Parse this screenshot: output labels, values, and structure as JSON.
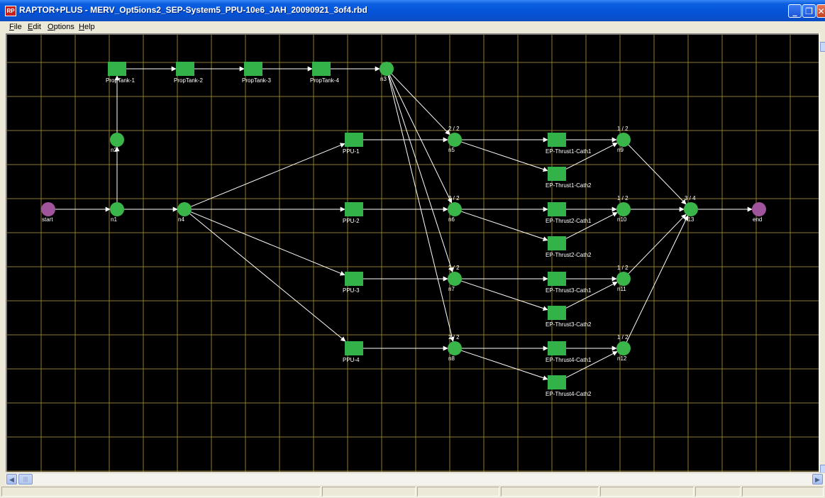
{
  "window": {
    "title": "RAPTOR+PLUS - MERV_Opt5ions2_SEP-System5_PPU-10e6_JAH_20090921_3of4.rbd"
  },
  "menu": [
    {
      "label": "File"
    },
    {
      "label": "Edit"
    },
    {
      "label": "Options"
    },
    {
      "label": "Help"
    }
  ],
  "colors": {
    "block": "#33b24a",
    "node": "#3ab54a",
    "terminal": "#a0549b",
    "grid": "#8f7a2e",
    "canvas": "#000000",
    "label": "#ffffff"
  },
  "diagram": {
    "terminals": [
      {
        "id": "start",
        "label": "start"
      },
      {
        "id": "end",
        "label": "end"
      }
    ],
    "nodes": [
      {
        "id": "n1",
        "label": "n1",
        "vote": ""
      },
      {
        "id": "n2",
        "label": "n2",
        "vote": ""
      },
      {
        "id": "n3",
        "label": "n3",
        "vote": ""
      },
      {
        "id": "n4",
        "label": "n4",
        "vote": ""
      },
      {
        "id": "n5",
        "label": "n5",
        "vote": "2 / 2"
      },
      {
        "id": "n6",
        "label": "n6",
        "vote": "2 / 2"
      },
      {
        "id": "n7",
        "label": "n7",
        "vote": "2 / 2"
      },
      {
        "id": "n8",
        "label": "n8",
        "vote": "2 / 2"
      },
      {
        "id": "n9",
        "label": "n9",
        "vote": "1 / 2"
      },
      {
        "id": "n10",
        "label": "n10",
        "vote": "1 / 2"
      },
      {
        "id": "n11",
        "label": "n11",
        "vote": "1 / 2"
      },
      {
        "id": "n12",
        "label": "n12",
        "vote": "1 / 2"
      },
      {
        "id": "n13",
        "label": "n13",
        "vote": "3 / 4"
      }
    ],
    "blocks": [
      {
        "id": "pt1",
        "label": "PropTank-1"
      },
      {
        "id": "pt2",
        "label": "PropTank-2"
      },
      {
        "id": "pt3",
        "label": "PropTank-3"
      },
      {
        "id": "pt4",
        "label": "PropTank-4"
      },
      {
        "id": "ppu1",
        "label": "PPU-1"
      },
      {
        "id": "ppu2",
        "label": "PPU-2"
      },
      {
        "id": "ppu3",
        "label": "PPU-3"
      },
      {
        "id": "ppu4",
        "label": "PPU-4"
      },
      {
        "id": "t1c1",
        "label": "EP-Thrust1-Cath1"
      },
      {
        "id": "t1c2",
        "label": "EP-Thrust1-Cath2"
      },
      {
        "id": "t2c1",
        "label": "EP-Thrust2-Cath1"
      },
      {
        "id": "t2c2",
        "label": "EP-Thrust2-Cath2"
      },
      {
        "id": "t3c1",
        "label": "EP-Thrust3-Cath1"
      },
      {
        "id": "t3c2",
        "label": "EP-Thrust3-Cath2"
      },
      {
        "id": "t4c1",
        "label": "EP-Thrust4-Cath1"
      },
      {
        "id": "t4c2",
        "label": "EP-Thrust4-Cath2"
      }
    ],
    "links": [
      [
        "start",
        "n1"
      ],
      [
        "n1",
        "n2"
      ],
      [
        "n1",
        "n4"
      ],
      [
        "n2",
        "pt1"
      ],
      [
        "pt1",
        "pt2"
      ],
      [
        "pt2",
        "pt3"
      ],
      [
        "pt3",
        "pt4"
      ],
      [
        "pt4",
        "n3"
      ],
      [
        "n4",
        "ppu1"
      ],
      [
        "n4",
        "ppu2"
      ],
      [
        "n4",
        "ppu3"
      ],
      [
        "n4",
        "ppu4"
      ],
      [
        "n3",
        "n5"
      ],
      [
        "n3",
        "n6"
      ],
      [
        "n3",
        "n7"
      ],
      [
        "n3",
        "n8"
      ],
      [
        "ppu1",
        "n5"
      ],
      [
        "ppu2",
        "n6"
      ],
      [
        "ppu3",
        "n7"
      ],
      [
        "ppu4",
        "n8"
      ],
      [
        "n5",
        "t1c1"
      ],
      [
        "n5",
        "t1c2"
      ],
      [
        "n6",
        "t2c1"
      ],
      [
        "n6",
        "t2c2"
      ],
      [
        "n7",
        "t3c1"
      ],
      [
        "n7",
        "t3c2"
      ],
      [
        "n8",
        "t4c1"
      ],
      [
        "n8",
        "t4c2"
      ],
      [
        "t1c1",
        "n9"
      ],
      [
        "t1c2",
        "n9"
      ],
      [
        "t2c1",
        "n10"
      ],
      [
        "t2c2",
        "n10"
      ],
      [
        "t3c1",
        "n11"
      ],
      [
        "t3c2",
        "n11"
      ],
      [
        "t4c1",
        "n12"
      ],
      [
        "t4c2",
        "n12"
      ],
      [
        "n9",
        "n13"
      ],
      [
        "n10",
        "n13"
      ],
      [
        "n11",
        "n13"
      ],
      [
        "n12",
        "n13"
      ],
      [
        "n13",
        "end"
      ]
    ]
  }
}
